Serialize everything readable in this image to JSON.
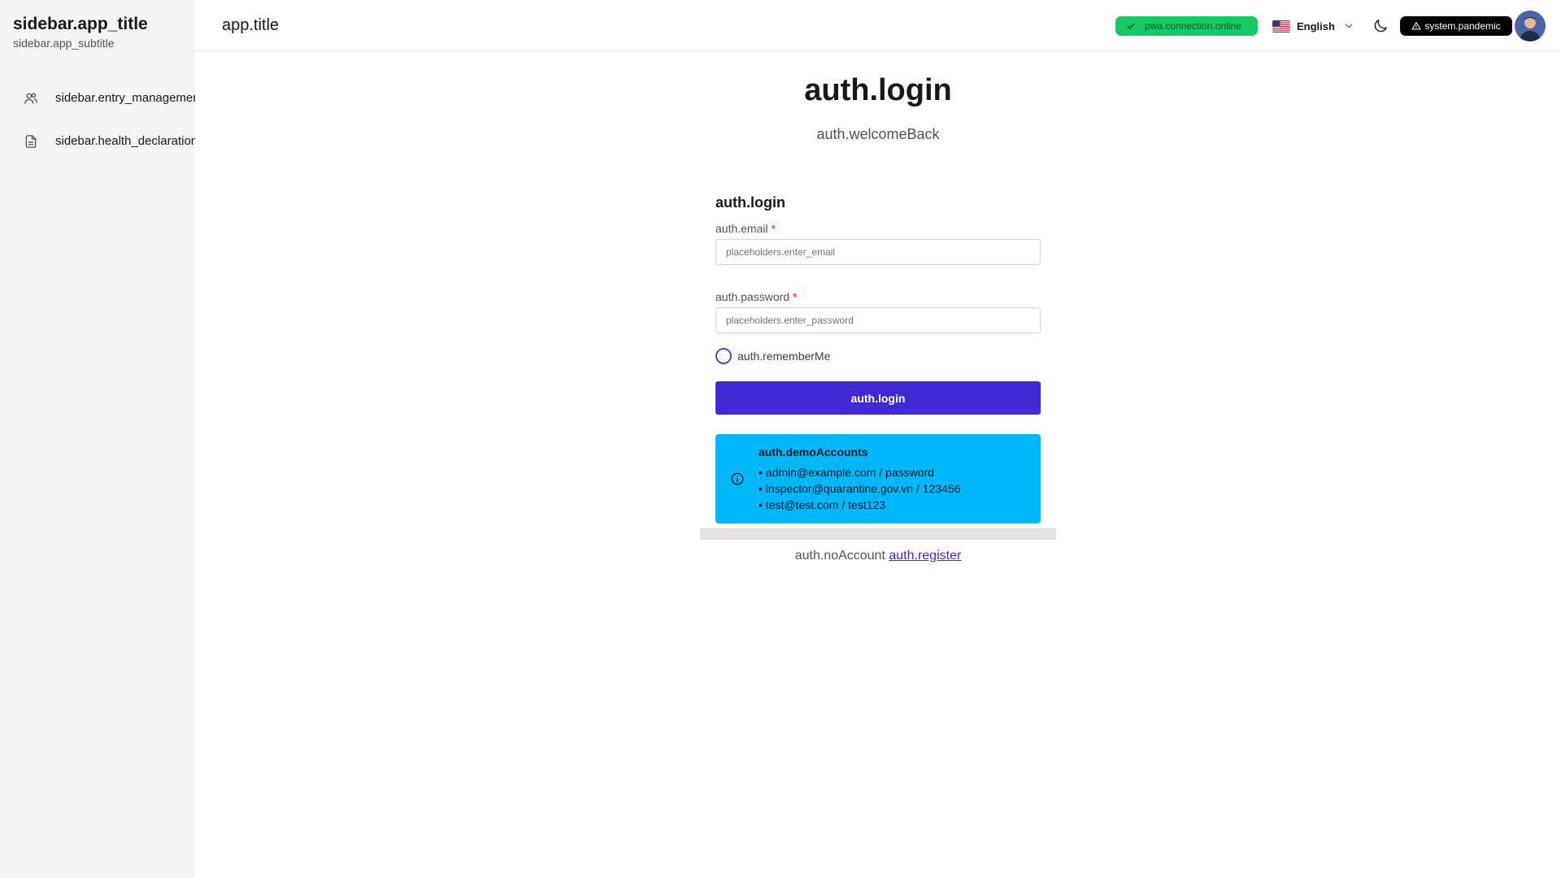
{
  "sidebar": {
    "app_title": "sidebar.app_title",
    "app_subtitle": "sidebar.app_subtitle",
    "items": [
      {
        "label": "sidebar.entry_management",
        "icon": "users-icon"
      },
      {
        "label": "sidebar.health_declaration",
        "icon": "document-icon"
      }
    ]
  },
  "header": {
    "title": "app.title",
    "connection_status": "pwa.connection.online",
    "language": "English",
    "system_badge": "system.pandemic"
  },
  "main": {
    "title": "auth.login",
    "subtitle": "auth.welcomeBack"
  },
  "login_form": {
    "title": "auth.login",
    "email_label": "auth.email",
    "email_placeholder": "placeholders.enter_email",
    "email_value": "",
    "password_label": "auth.password",
    "password_placeholder": "placeholders.enter_password",
    "password_value": "",
    "required_marker": "*",
    "remember_label": "auth.rememberMe",
    "remember_checked": false,
    "submit_label": "auth.login"
  },
  "demo_accounts": {
    "title": "auth.demoAccounts",
    "lines": [
      "• admin@example.com / password",
      "• inspector@quarantine.gov.vn / 123456",
      "• test@test.com / test123"
    ]
  },
  "footer": {
    "no_account": "auth.noAccount",
    "register_link": "auth.register"
  },
  "colors": {
    "primary": "#3f2ad6",
    "success": "#17c964",
    "info": "#00b7fa",
    "danger": "#f31260",
    "sidebar_bg": "#f4f4f5"
  }
}
